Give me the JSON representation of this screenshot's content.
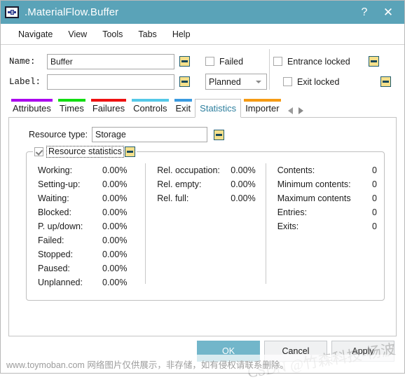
{
  "window": {
    "title": ".MaterialFlow.Buffer",
    "icon": "buffer-object-icon",
    "help_label": "?",
    "close_label": "✕",
    "titlebar_color": "#5aa3b8"
  },
  "menubar": {
    "items": [
      {
        "label": "Navigate"
      },
      {
        "label": "View"
      },
      {
        "label": "Tools"
      },
      {
        "label": "Tabs"
      },
      {
        "label": "Help"
      }
    ]
  },
  "topform": {
    "name_label": "Name:",
    "name_value": "Buffer",
    "name_placeholder": "",
    "label_label": "Label:",
    "label_value": "",
    "label_placeholder": "",
    "failed_label": "Failed",
    "failed_checked": false,
    "planned_value": "Planned",
    "entrance_locked_label": "Entrance locked",
    "entrance_locked_checked": false,
    "exit_locked_label": "Exit locked",
    "exit_locked_checked": false
  },
  "tabs": {
    "items": [
      {
        "label": "Attributes",
        "color": "#aa00ee",
        "active": false
      },
      {
        "label": "Times",
        "color": "#11dd11",
        "active": false
      },
      {
        "label": "Failures",
        "color": "#ee1111",
        "active": false
      },
      {
        "label": "Controls",
        "color": "#55c8e8",
        "active": false
      },
      {
        "label": "Exit",
        "color": "#3a9be0",
        "active": false
      },
      {
        "label": "Statistics",
        "color": "#888888",
        "active": true
      },
      {
        "label": "Importer",
        "color": "#f59b14",
        "active": false
      }
    ],
    "scroll_left": "scroll-left-arrow",
    "scroll_right": "scroll-right-arrow"
  },
  "statistics_tab": {
    "resource_type_label": "Resource type:",
    "resource_type_value": "Storage",
    "group_title": "Resource statistics",
    "group_checked": true,
    "columns": [
      {
        "name": "state-statistics",
        "rows": [
          {
            "label": "Working:",
            "value": "0.00%"
          },
          {
            "label": "Setting-up:",
            "value": "0.00%"
          },
          {
            "label": "Waiting:",
            "value": "0.00%"
          },
          {
            "label": "Blocked:",
            "value": "0.00%"
          },
          {
            "label": "P. up/down:",
            "value": "0.00%"
          },
          {
            "label": "Failed:",
            "value": "0.00%"
          },
          {
            "label": "Stopped:",
            "value": "0.00%"
          },
          {
            "label": "Paused:",
            "value": "0.00%"
          },
          {
            "label": "Unplanned:",
            "value": "0.00%"
          }
        ]
      },
      {
        "name": "relative-statistics",
        "rows": [
          {
            "label": "Rel. occupation:",
            "value": "0.00%"
          },
          {
            "label": "Rel. empty:",
            "value": "0.00%"
          },
          {
            "label": "Rel. full:",
            "value": "0.00%"
          }
        ]
      },
      {
        "name": "contents-statistics",
        "rows": [
          {
            "label": "Contents:",
            "value": "0"
          },
          {
            "label": "Minimum contents:",
            "value": "0"
          },
          {
            "label": "Maximum contents",
            "value": "0"
          },
          {
            "label": "Entries:",
            "value": "0"
          },
          {
            "label": "Exits:",
            "value": "0"
          }
        ]
      }
    ]
  },
  "footer": {
    "ok_label": "OK",
    "cancel_label": "Cancel",
    "apply_label": "Apply",
    "ok_color": "#72b6ca"
  },
  "watermarks": {
    "bottom": "www.toymoban.com 网络图片仅供展示，非存储，如有侵权请联系删除。",
    "diagonal": "CSDN @竹森科技-杨波"
  }
}
